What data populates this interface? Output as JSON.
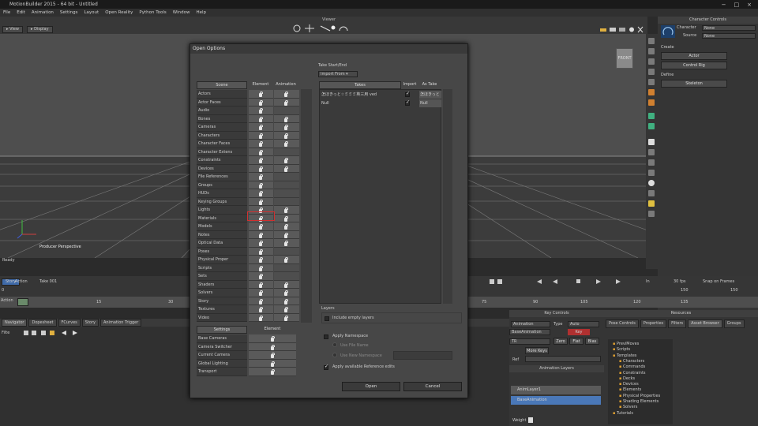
{
  "app": {
    "title": "MotionBuilder 2015 - 64 bit - Untitled",
    "window_buttons": [
      "−",
      "□",
      "×"
    ]
  },
  "menu": [
    "File",
    "Edit",
    "Animation",
    "Settings",
    "Layout",
    "Open Reality",
    "Python Tools",
    "Window",
    "Help"
  ],
  "viewer": {
    "label": "Viewer",
    "view_btn": "View",
    "display_btn": "Display",
    "cube_label": "FRONT",
    "camera_label": "Producer Perspective"
  },
  "status": {
    "text": "Ready"
  },
  "character_controls": {
    "title": "Character Controls",
    "character_label": "Character",
    "character_value": "None",
    "source_label": "Source",
    "source_value": "None",
    "create_label": "Create",
    "actor_btn": "Actor",
    "control_rig_btn": "Control Rig",
    "define_label": "Define",
    "skeleton_btn": "Skeleton"
  },
  "transport": {
    "story_btn": "Story",
    "action_label": "Action",
    "take_label": "Take 001",
    "fps_mode": "In",
    "fps_value": "30 fps",
    "snap_value": "Snap on Frames",
    "start_value": "0",
    "end_value": "150",
    "frame_start": "150",
    "frame_end": "150",
    "action_row_label": "Action",
    "ticks": [
      "15",
      "30",
      "75",
      "90",
      "105",
      "120",
      "135"
    ]
  },
  "lower_tabs": [
    "Navigator",
    "Dopesheet",
    "FCurves",
    "Story",
    "Animation Trigger"
  ],
  "navigator": {
    "filter_label": "Filte"
  },
  "key_controls": {
    "title": "Key Controls",
    "animation_dropdown": "Animation",
    "type_label": "Type",
    "type_value": "Auto",
    "base_animation": "BaseAnimation",
    "key_label": "Key",
    "zero_btn": "Zero",
    "flat_btn": "Flat",
    "bias_btn": "Bias",
    "tr_value": "TR",
    "more_keys_btn": "More Keys",
    "ref_label": "Ref",
    "animation_layers_title": "Animation Layers",
    "layer1": "AnimLayer1",
    "base_layer": "BaseAnimation",
    "weight_label": "Weight"
  },
  "resources": {
    "title": "Resources",
    "tabs": [
      "Pose Controls",
      "Properties",
      "Filters",
      "Asset Browser",
      "Groups"
    ],
    "tree": [
      {
        "label": "PreviMoves",
        "indent": 0
      },
      {
        "label": "Scripts",
        "indent": 0
      },
      {
        "label": "Templates",
        "indent": 0
      },
      {
        "label": "Characters",
        "indent": 1
      },
      {
        "label": "Commands",
        "indent": 1
      },
      {
        "label": "Constraints",
        "indent": 1
      },
      {
        "label": "Decks",
        "indent": 1
      },
      {
        "label": "Devices",
        "indent": 1
      },
      {
        "label": "Elements",
        "indent": 1
      },
      {
        "label": "Physical Properties",
        "indent": 1
      },
      {
        "label": "Shading Elements",
        "indent": 1
      },
      {
        "label": "Solvers",
        "indent": 1
      },
      {
        "label": "Tutorials",
        "indent": 0
      }
    ]
  },
  "dialog": {
    "title": "Open Options",
    "take_start_end": "Take Start/End",
    "import_from": "Import From",
    "scene_header": "Scene",
    "element_header": "Element",
    "animation_header": "Animation",
    "takes_header": "Takes",
    "import_header": "Import",
    "as_take_header": "As Take",
    "scene_rows": [
      {
        "label": "Actors",
        "anim": true
      },
      {
        "label": "Actor Faces",
        "anim": true
      },
      {
        "label": "Audio",
        "anim": false
      },
      {
        "label": "Bones",
        "anim": true
      },
      {
        "label": "Cameras",
        "anim": true
      },
      {
        "label": "Characters",
        "anim": true
      },
      {
        "label": "Character Faces",
        "anim": true
      },
      {
        "label": "Character Extens",
        "anim": false
      },
      {
        "label": "Constraints",
        "anim": true
      },
      {
        "label": "Devices",
        "anim": true
      },
      {
        "label": "File References",
        "anim": false
      },
      {
        "label": "Groups",
        "anim": false
      },
      {
        "label": "HUDs",
        "anim": false
      },
      {
        "label": "Keying Groups",
        "anim": false
      },
      {
        "label": "Lights",
        "anim": true
      },
      {
        "label": "Materials",
        "anim": true
      },
      {
        "label": "Models",
        "anim": true
      },
      {
        "label": "Notes",
        "anim": true
      },
      {
        "label": "Optical Data",
        "anim": true
      },
      {
        "label": "Poses",
        "anim": false
      },
      {
        "label": "Physical Proper",
        "anim": true
      },
      {
        "label": "Scripts",
        "anim": false
      },
      {
        "label": "Sets",
        "anim": false
      },
      {
        "label": "Shaders",
        "anim": true
      },
      {
        "label": "Solvers",
        "anim": true
      },
      {
        "label": "Story",
        "anim": true
      },
      {
        "label": "Textures",
        "anim": true
      },
      {
        "label": "Video",
        "anim": true
      }
    ],
    "takes": [
      {
        "name": "怎ほきっと☆ミミミ英三用 ved",
        "import": true,
        "as_take": "怎ほきっと"
      },
      {
        "name": "Null",
        "import": true,
        "as_take": "Null"
      }
    ],
    "settings_header": "Settings",
    "settings_element_header": "Element",
    "settings_rows": [
      "Base Cameras",
      "Camera Switcher",
      "Current Camera",
      "Global Lighting",
      "Transport"
    ],
    "layers_label": "Layers",
    "include_empty_layers": "Include empty layers",
    "apply_namespace": "Apply Namespace",
    "use_file_name": "Use File Name",
    "use_new_namespace": "Use New Namespace",
    "apply_reference_edits": "Apply available Reference edits",
    "open_btn": "Open",
    "cancel_btn": "Cancel"
  }
}
